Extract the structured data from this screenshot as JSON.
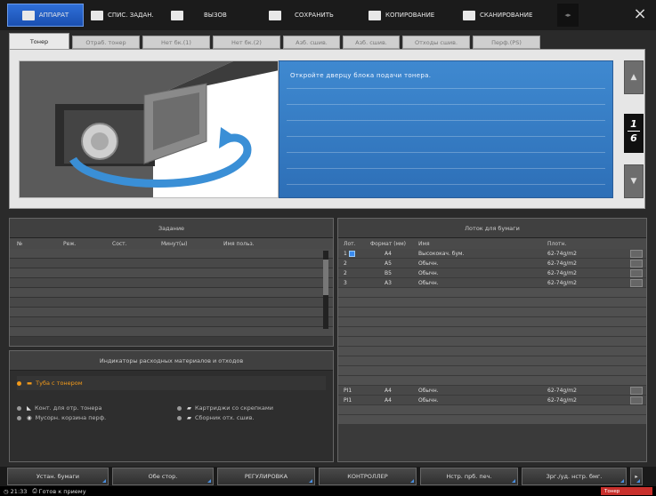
{
  "top_menu": [
    {
      "label": "АППАРАТ",
      "icon": "printer-icon"
    },
    {
      "label": "СПИС. ЗАДАН.",
      "icon": "list-icon"
    },
    {
      "label": "ВЫЗОВ",
      "icon": "recall-icon"
    },
    {
      "label": "СОХРАНИТЬ",
      "icon": "save-icon"
    },
    {
      "label": "КОПИРОВАНИЕ",
      "icon": "copy-icon"
    },
    {
      "label": "СКАНИРОВАНИЕ",
      "icon": "scan-icon"
    }
  ],
  "close_label": "×",
  "tabs": [
    "Тонер",
    "Отраб. тонер",
    "Нет бк.(1)",
    "Нет бк.(2)",
    "Азб. сшив.",
    "Азб. сшив.",
    "Отходы сшив.",
    "Перф.(PS)"
  ],
  "message": "Откройте дверцу блока подачи тонера.",
  "page_indicator": {
    "current": "1",
    "total": "6"
  },
  "scroll_up": "▲",
  "scroll_down": "▼",
  "job": {
    "title": "Задание",
    "columns": [
      "№",
      "Реж.",
      "Сост.",
      "Минут(ы)",
      "Имя польз."
    ]
  },
  "consumables": {
    "title": "Индикаторы расходных материалов и отходов",
    "warning": "Туба с тонером",
    "items": [
      "Конт. для отр. тонера",
      "Картриджи со скрепками",
      "Мусорн. корзина перф.",
      "Сборник отх. сшив."
    ]
  },
  "tray": {
    "title": "Лоток для бумаги",
    "columns": [
      "Лот.",
      "Формат (мм)",
      "Имя",
      "Плотн."
    ],
    "rows": [
      {
        "tray": "1",
        "format": "A4",
        "name": "Высококач. бум.",
        "weight": "62-74g/m2",
        "selected": true
      },
      {
        "tray": "2",
        "format": "A5",
        "name": "Обычн.",
        "weight": "62-74g/m2"
      },
      {
        "tray": "2",
        "format": "B5",
        "name": "Обычн.",
        "weight": "62-74g/m2"
      },
      {
        "tray": "3",
        "format": "A3",
        "name": "Обычн.",
        "weight": "62-74g/m2"
      }
    ],
    "pi_rows": [
      {
        "tray": "PI1",
        "format": "A4",
        "name": "Обычн.",
        "weight": "62-74g/m2"
      },
      {
        "tray": "PI1",
        "format": "A4",
        "name": "Обычн.",
        "weight": "62-74g/m2"
      }
    ]
  },
  "bottom_buttons": [
    "Устан. бумаги",
    "Обе стор.",
    "РЕГУЛИРОВКА",
    "КОНТРОЛЛЕР",
    "Нстр. прб. печ.",
    "Зрг./уд. нстр. бмг."
  ],
  "bottom_arrow": "▸",
  "status": {
    "time": "21:33",
    "text": "Готов к приему",
    "alert": "Тонер"
  }
}
